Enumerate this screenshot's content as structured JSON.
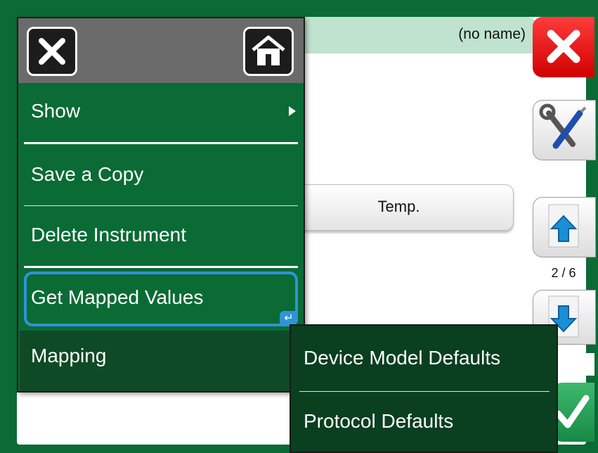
{
  "screen": {
    "title": "(no name)",
    "temp_button": "Temp.",
    "page_indicator": "2 / 6"
  },
  "menu": {
    "items": [
      {
        "label": "Show",
        "has_submenu": true
      },
      {
        "label": "Save a Copy"
      },
      {
        "label": "Delete Instrument"
      },
      {
        "label": "Get Mapped Values",
        "selected": true
      },
      {
        "label": "Mapping",
        "open": true
      }
    ],
    "enter_badge": "↵"
  },
  "submenu": {
    "items": [
      "Device Model Defaults",
      "Protocol Defaults"
    ]
  },
  "colors": {
    "background": "#0a6b35",
    "menu_bg": "#0a6b35",
    "submenu_bg": "#0a3f20",
    "selection": "#2f93d6",
    "close_red": "#e00000"
  },
  "icons": {
    "close": "close-icon",
    "home": "home-icon",
    "tools": "tools-icon",
    "page_up": "page-up-icon",
    "page_down": "page-down-icon",
    "accept": "checkmark-icon"
  }
}
